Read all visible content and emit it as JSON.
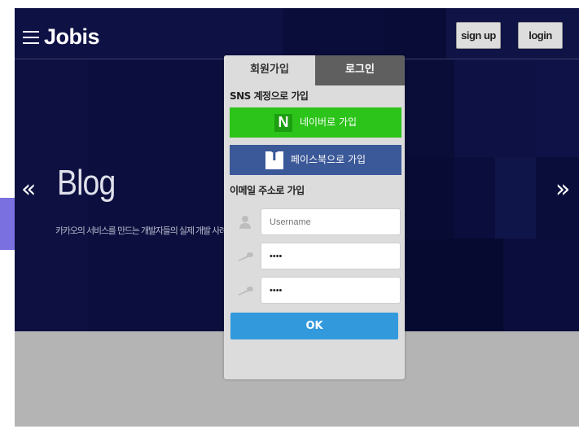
{
  "header": {
    "brand": "Jobis",
    "signup_label": "sign up",
    "login_label": "login"
  },
  "hero": {
    "title": "Blog",
    "subtitle": "카카오의 서비스를 만드는 개발자들의 실제 개발 사례",
    "prev_arrow": "«",
    "next_arrow": "»"
  },
  "modal": {
    "tabs": [
      {
        "label": "회원가입",
        "active": true
      },
      {
        "label": "로그인",
        "active": false
      }
    ],
    "sns_section_label": "SNS 계정으로 가입",
    "naver_logo": "N",
    "naver_label": "네이버로 가입",
    "facebook_logo": "f",
    "facebook_label": "페이스북으로 가입",
    "email_section_label": "이메일 주소로 가입",
    "username_placeholder": "Username",
    "password_value": "••••",
    "password_confirm_value": "••••",
    "ok_label": "OK"
  },
  "colors": {
    "hero_bg": "#0c0e3c",
    "naver_green": "#2cc41a",
    "facebook_blue": "#3b5898",
    "ok_blue": "#3399dd",
    "tab_inactive": "#5f5f5f",
    "accent_purple": "#7a70df"
  },
  "icons": [
    "menu-icon",
    "user-icon",
    "key-icon",
    "naver-logo",
    "facebook-logo",
    "chevron-left-icon",
    "chevron-right-icon"
  ]
}
